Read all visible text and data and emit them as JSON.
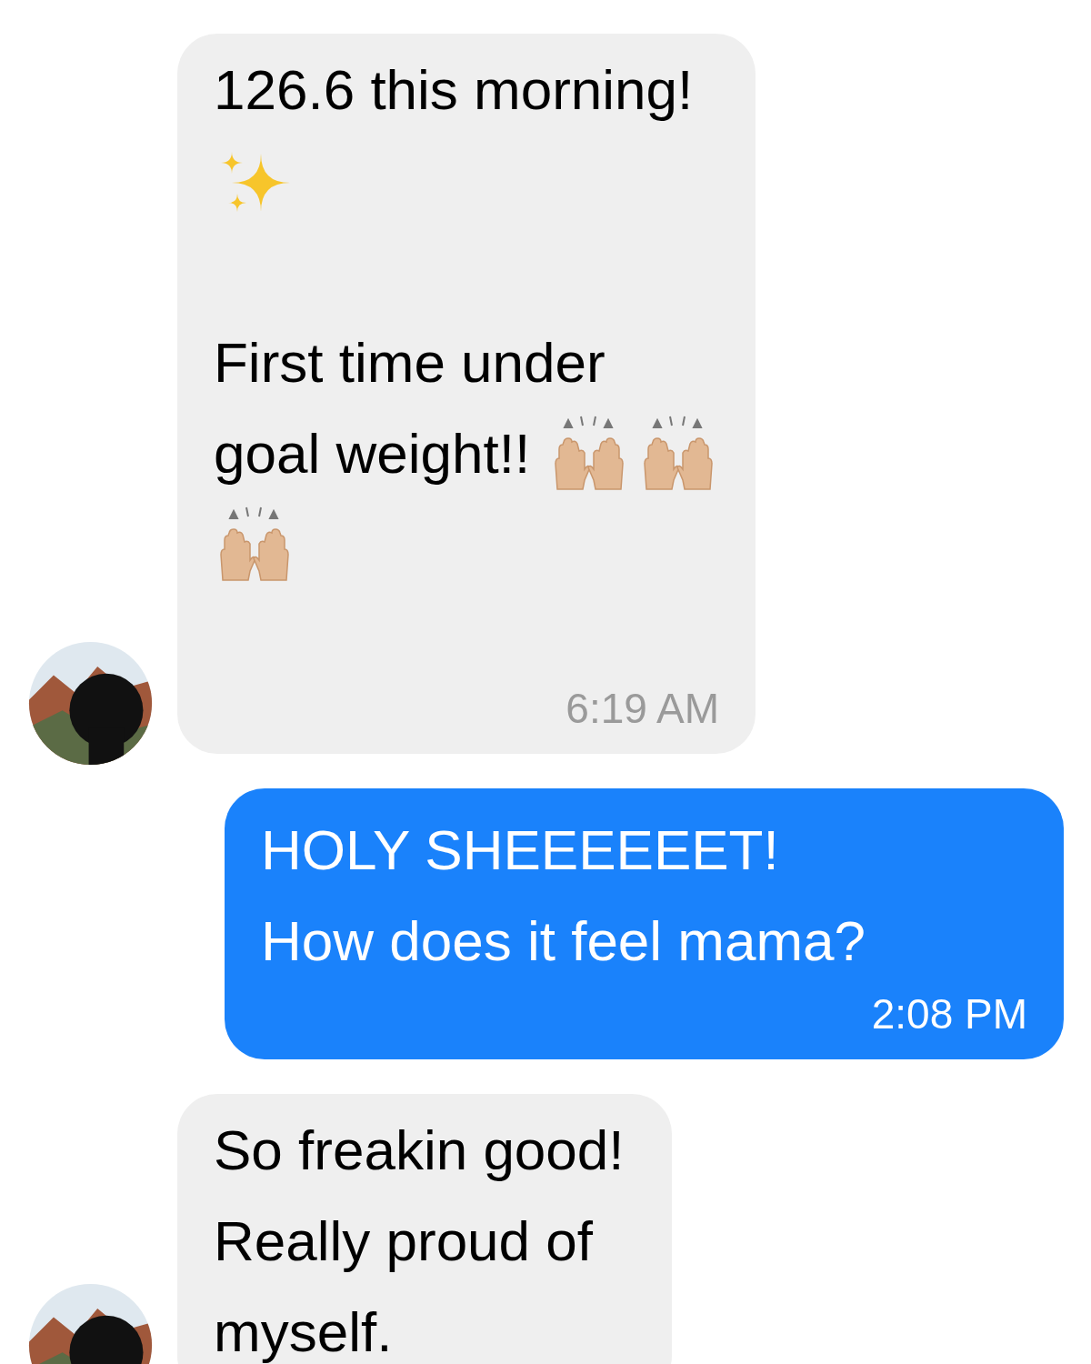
{
  "messages": [
    {
      "kind": "incoming",
      "paragraphs": [
        [
          [
            {
              "kind": "text",
              "text": "126.6 this morning!"
            }
          ],
          [
            {
              "kind": "sparkles"
            }
          ]
        ],
        [
          [
            {
              "kind": "text",
              "text": "First time under"
            }
          ],
          [
            {
              "kind": "text",
              "text": "goal weight!!"
            },
            {
              "kind": "hands"
            },
            {
              "kind": "hands"
            }
          ],
          [
            {
              "kind": "hands"
            }
          ]
        ]
      ],
      "time": "6:19 AM"
    },
    {
      "kind": "outgoing",
      "paragraphs": [
        [
          [
            {
              "kind": "text",
              "text": "HOLY SHEEEEEET!"
            }
          ],
          [
            {
              "kind": "text",
              "text": "How does it feel mama?"
            }
          ]
        ]
      ],
      "time": "2:08 PM"
    },
    {
      "kind": "incoming",
      "paragraphs": [
        [
          [
            {
              "kind": "text",
              "text": "So freakin good!"
            }
          ],
          [
            {
              "kind": "text",
              "text": "Really proud of"
            }
          ],
          [
            {
              "kind": "text",
              "text": "myself."
            }
          ]
        ]
      ]
    }
  ]
}
